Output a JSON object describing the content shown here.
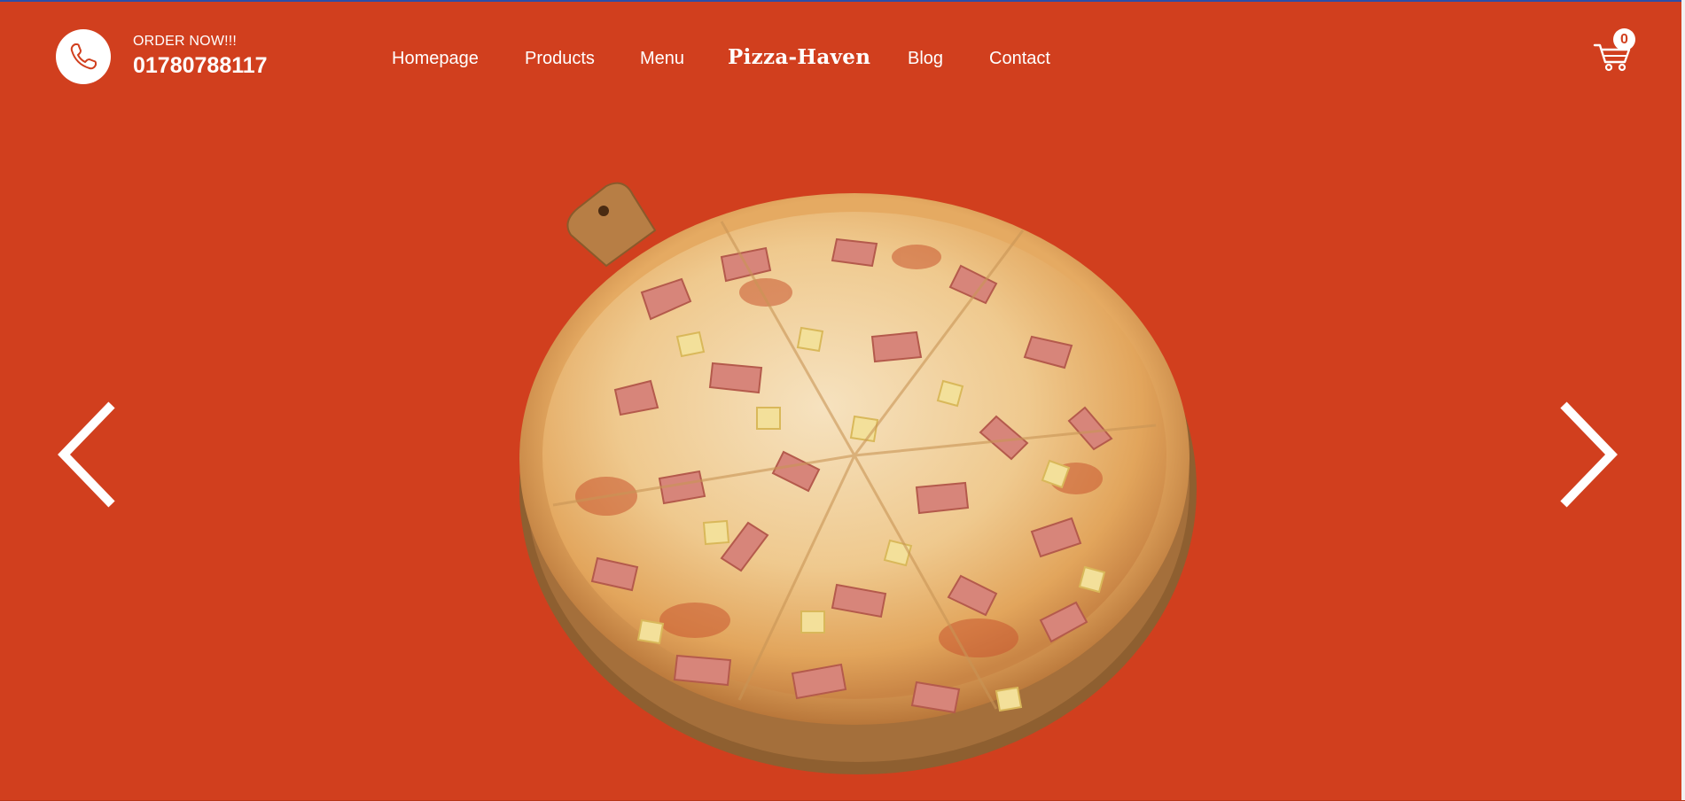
{
  "header": {
    "order_label": "ORDER NOW!!!",
    "phone_number": "01780788117",
    "brand": "Pizza-Haven",
    "nav": {
      "homepage": "Homepage",
      "products": "Products",
      "menu": "Menu",
      "blog": "Blog",
      "contact": "Contact"
    },
    "cart_count": "0"
  },
  "colors": {
    "background": "#d13f1e",
    "text": "#ffffff",
    "accent": "#d13f1e"
  },
  "icons": {
    "phone": "phone-icon",
    "cart": "cart-icon",
    "prev": "chevron-left-icon",
    "next": "chevron-right-icon"
  }
}
